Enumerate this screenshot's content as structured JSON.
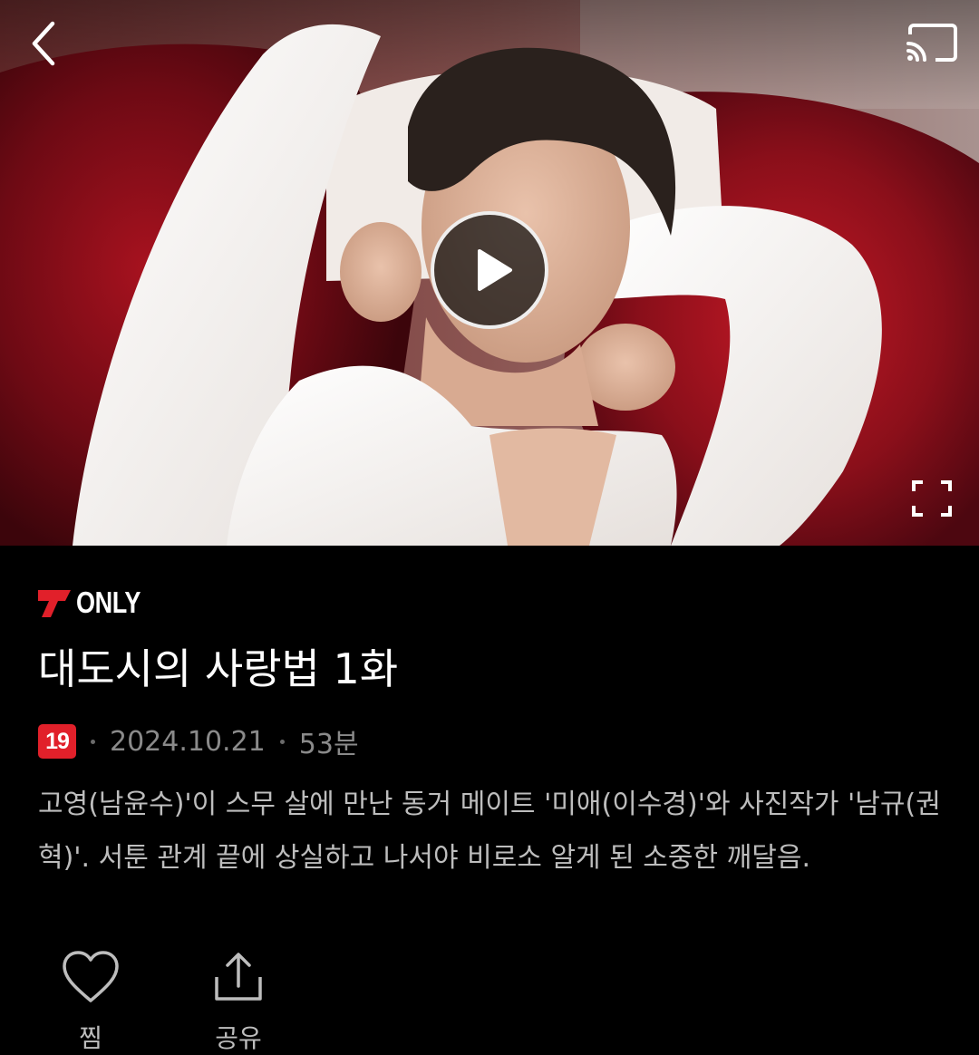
{
  "player": {
    "back_icon": "chevron-left-icon",
    "cast_icon": "cast-icon",
    "play_icon": "play-icon",
    "fullscreen_icon": "fullscreen-icon"
  },
  "program": {
    "badge_text": "ONLY",
    "badge_color": "#e1202a",
    "title": "대도시의 사랑법 1화",
    "age_rating": "19",
    "air_date": "2024.10.21",
    "duration": "53분",
    "description": "고영(남윤수)'이 스무 살에 만난 동거 메이트 '미애(이수경)'와 사진작가 '남규(권혁)'. 서툰 관계 끝에 상실하고 나서야 비로소 알게 된 소중한 깨달음."
  },
  "actions": {
    "like_label": "찜",
    "like_icon": "heart-icon",
    "share_label": "공유",
    "share_icon": "share-icon"
  }
}
